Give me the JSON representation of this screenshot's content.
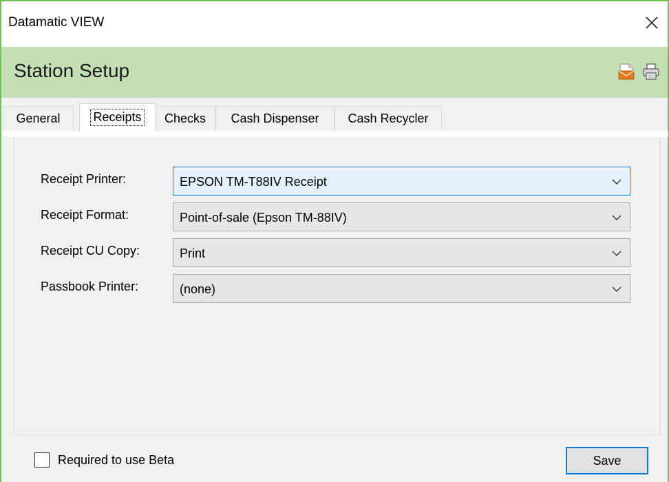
{
  "window": {
    "title": "Datamatic VIEW",
    "close_icon": "close-icon"
  },
  "header": {
    "title": "Station Setup",
    "icons": [
      "email-icon",
      "printer-icon"
    ]
  },
  "tabs": [
    {
      "label": "General",
      "active": false
    },
    {
      "label": "Receipts",
      "active": true
    },
    {
      "label": "Checks",
      "active": false
    },
    {
      "label": "Cash Dispenser",
      "active": false
    },
    {
      "label": "Cash Recycler",
      "active": false
    }
  ],
  "form": {
    "fields": [
      {
        "label": "Receipt Printer:",
        "value": "EPSON TM-T88IV Receipt"
      },
      {
        "label": "Receipt Format:",
        "value": "Point-of-sale (Epson TM-88IV)"
      },
      {
        "label": "Receipt CU Copy:",
        "value": "Print"
      },
      {
        "label": "Passbook Printer:",
        "value": "(none)"
      }
    ]
  },
  "footer": {
    "checkbox_label": "Required to use Beta",
    "checkbox_checked": false,
    "save_label": "Save"
  },
  "colors": {
    "header_bg": "#c5dfb4",
    "window_border": "#6fbf5a",
    "focus_blue": "#0078d7",
    "email_icon": "#e07b22"
  }
}
